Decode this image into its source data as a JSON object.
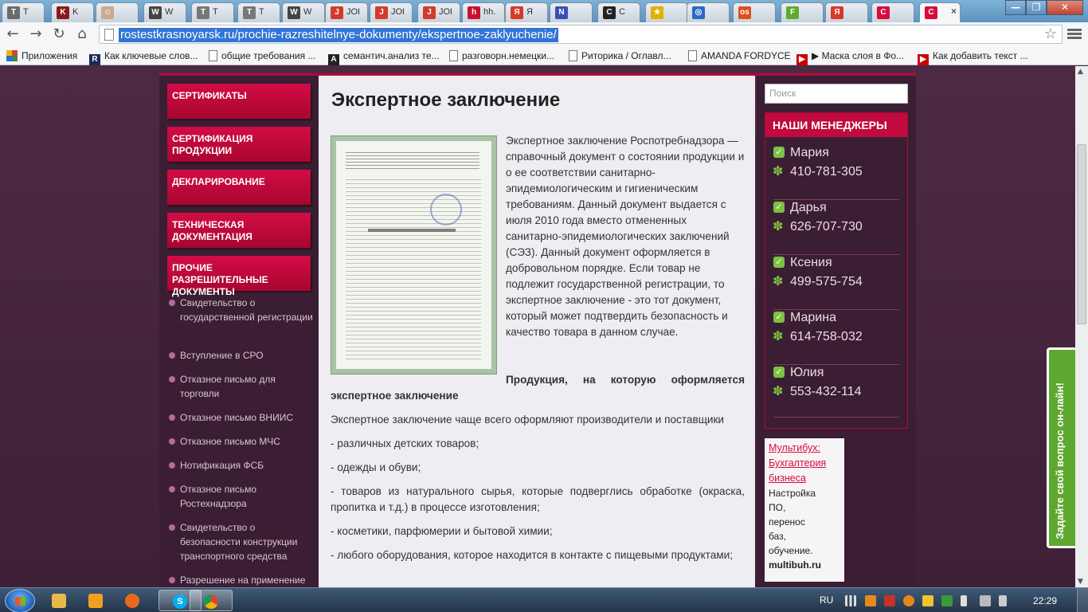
{
  "browser": {
    "tabs": [
      {
        "icon": "T",
        "title": "Т",
        "color": "#6b6b6b"
      },
      {
        "icon": "K",
        "title": "K",
        "color": "#8b1a1a"
      },
      {
        "icon": "☺",
        "title": "",
        "color": "#c9ab8f"
      },
      {
        "icon": "W",
        "title": "W",
        "color": "#444444"
      },
      {
        "icon": "T",
        "title": "T",
        "color": "#777777"
      },
      {
        "icon": "T",
        "title": "T",
        "color": "#777777"
      },
      {
        "icon": "W",
        "title": "W",
        "color": "#444444"
      },
      {
        "icon": "J",
        "title": "JOB",
        "color": "#d23b2b"
      },
      {
        "icon": "J",
        "title": "JOB",
        "color": "#d23b2b"
      },
      {
        "icon": "J",
        "title": "JOB",
        "color": "#d23b2b"
      },
      {
        "icon": "h",
        "title": "hh.",
        "color": "#c8102e"
      },
      {
        "icon": "Я",
        "title": "Я",
        "color": "#d9372b"
      },
      {
        "icon": "N",
        "title": "",
        "color": "#3b4eb8"
      },
      {
        "icon": "C",
        "title": "C",
        "color": "#222222"
      },
      {
        "icon": "★",
        "title": "",
        "color": "#e0b100"
      },
      {
        "icon": "◎",
        "title": "",
        "color": "#2a6ac0"
      },
      {
        "icon": "os",
        "title": "",
        "color": "#e04e1c"
      },
      {
        "icon": "F",
        "title": "",
        "color": "#5fa82f"
      },
      {
        "icon": "Я",
        "title": "",
        "color": "#d9372b"
      },
      {
        "icon": "C",
        "title": "",
        "color": "#d80c3d"
      },
      {
        "icon": "C",
        "title": "",
        "color": "#d80c3d"
      }
    ],
    "active_tab_close": "×",
    "window_buttons": {
      "minimize": "—",
      "maximize": "❐",
      "close": "✕"
    },
    "url": "rostestkrasnoyarsk.ru/prochie-razreshitelnye-dokumenty/ekspertnoe-zaklyuchenie/",
    "nav_icons": {
      "back": "←",
      "forward": "→",
      "reload": "↻",
      "home": "⌂",
      "star": "☆"
    },
    "bookmarks": [
      {
        "label": "Приложения",
        "icon": "apps-grid",
        "color": "#d44638"
      },
      {
        "label": "Как ключевые слов...",
        "icon": "R",
        "color": "#1c2a5a"
      },
      {
        "label": "общие требования ...",
        "icon": "page",
        "color": "#ffffff"
      },
      {
        "label": "семантич.анализ те...",
        "icon": "A",
        "color": "#222222"
      },
      {
        "label": "разговорн.немецки...",
        "icon": "page",
        "color": "#ffffff"
      },
      {
        "label": "Риторика / Оглавл...",
        "icon": "page",
        "color": "#ffffff"
      },
      {
        "label": "AMANDA FORDYCE",
        "icon": "page",
        "color": "#ffffff"
      },
      {
        "label": "▶ Маска слоя в Фо...",
        "icon": "▶",
        "color": "#cc0000"
      },
      {
        "label": "Как добавить текст ...",
        "icon": "▶",
        "color": "#cc0000"
      }
    ]
  },
  "site": {
    "menu": [
      "СЕРТИФИКАТЫ",
      "СЕРТИФИКАЦИЯ ПРОДУКЦИИ",
      "ДЕКЛАРИРОВАНИЕ",
      "ТЕХНИЧЕСКАЯ ДОКУМЕНТАЦИЯ",
      "ПРОЧИЕ РАЗРЕШИТЕЛЬНЫЕ ДОКУМЕНТЫ"
    ],
    "submenu": [
      "Свидетельство о государственной регистрации",
      "Вступление в СРО",
      "Отказное письмо для торговли",
      "Отказное письмо ВНИИС",
      "Отказное письмо МЧС",
      "Нотификация ФСБ",
      "Отказное письмо Ростехнадзора",
      "Свидетельство о безопасности конструкции транспортного средства",
      "Разрешение на применение"
    ],
    "article": {
      "title": "Экспертное заключение",
      "intro": "Экспертное заключение Роспотребнадзора — справочный документ о состоянии продукции и о ее соответствии санитарно-эпидемиологическим и гигиеническим требованиям. Данный документ выдается с июля 2010 года вместо отмененных санитарно-эпидемиологических заключений (СЭЗ). Данный документ оформляется в добровольном порядке. Если товар не подлежит государственной регистрации, то экспертное заключение  - это тот документ, который может подтвердить безопасность и качество товара в данном случае.",
      "products_heading": "Продукция, на которую оформляется экспертное заключение",
      "products_intro": "Экспертное заключение чаще всего оформляют производители и поставщики",
      "items": [
        " - различных детских товаров;",
        "-  одежды и обуви;",
        "-  товаров из натурального сырья, которые подверглись обработке (окраска, пропитка и т.д.) в процессе изготовления;",
        "-  косметики, парфюмерии и бытовой химии;",
        "-  любого оборудования, которое находится в контакте с пищевыми продуктами;"
      ]
    },
    "search_placeholder": "Поиск",
    "managers_title": "НАШИ МЕНЕДЖЕРЫ",
    "managers": [
      {
        "name": "Мария",
        "phone": "410-781-305"
      },
      {
        "name": "Дарья",
        "phone": "626-707-730"
      },
      {
        "name": "Ксения",
        "phone": "499-575-754"
      },
      {
        "name": "Марина",
        "phone": "614-758-032"
      },
      {
        "name": "Юлия",
        "phone": "553-432-114"
      }
    ],
    "ad": {
      "link": "Мультибух: Бухгалтерия бизнеса",
      "text": "Настройка ПО, перенос баз, обучение.",
      "brand": "multibuh.ru"
    },
    "chat_tab": "Задайте свой вопрос он-лайн!"
  },
  "taskbar": {
    "apps": [
      {
        "icon": "folder",
        "color": "#e8b84a"
      },
      {
        "icon": "media",
        "color": "#f0a020"
      },
      {
        "icon": "firefox",
        "color": "#e76a1e"
      },
      {
        "icon": "S",
        "color": "#00aff0"
      },
      {
        "icon": "chrome",
        "color": "#4a9a3a"
      }
    ],
    "language": "RU",
    "clock": "22:29"
  }
}
